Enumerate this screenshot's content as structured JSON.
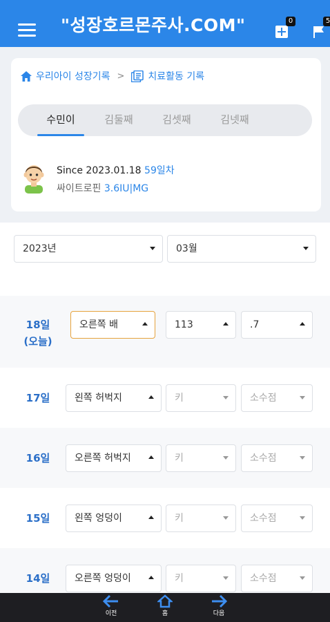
{
  "header": {
    "title": "\"성장호르몬주사.COM\"",
    "badge_left": "0",
    "badge_right": "5"
  },
  "breadcrumb": {
    "home": "우리아이 성장기록",
    "separator": ">",
    "current": "치료활동 기록"
  },
  "tabs": [
    {
      "label": "수민이",
      "active": true
    },
    {
      "label": "김둘째"
    },
    {
      "label": "김셋째"
    },
    {
      "label": "김넷째"
    }
  ],
  "profile": {
    "since": "Since 2023.01.18",
    "days": "59일차",
    "drug_label": "싸이트로핀",
    "drug_dose": "3.6IU|MG"
  },
  "filters": {
    "year": "2023년",
    "month": "03월"
  },
  "entries": [
    {
      "day": "18일",
      "today": "(오늘)",
      "site": "오른쪽 배",
      "height": "113",
      "decimal": ".7"
    },
    {
      "day": "17일",
      "site": "왼쪽 허벅지",
      "height": "키",
      "decimal": "소수점"
    },
    {
      "day": "16일",
      "site": "오른쪽 허벅지",
      "height": "키",
      "decimal": "소수점"
    },
    {
      "day": "15일",
      "site": "왼쪽 엉덩이",
      "height": "키",
      "decimal": "소수점"
    },
    {
      "day": "14일",
      "site": "오른쪽 엉덩이",
      "height": "키",
      "decimal": "소수점"
    }
  ],
  "bottom_nav": {
    "prev": "이전",
    "home": "홈",
    "next": "다음"
  }
}
